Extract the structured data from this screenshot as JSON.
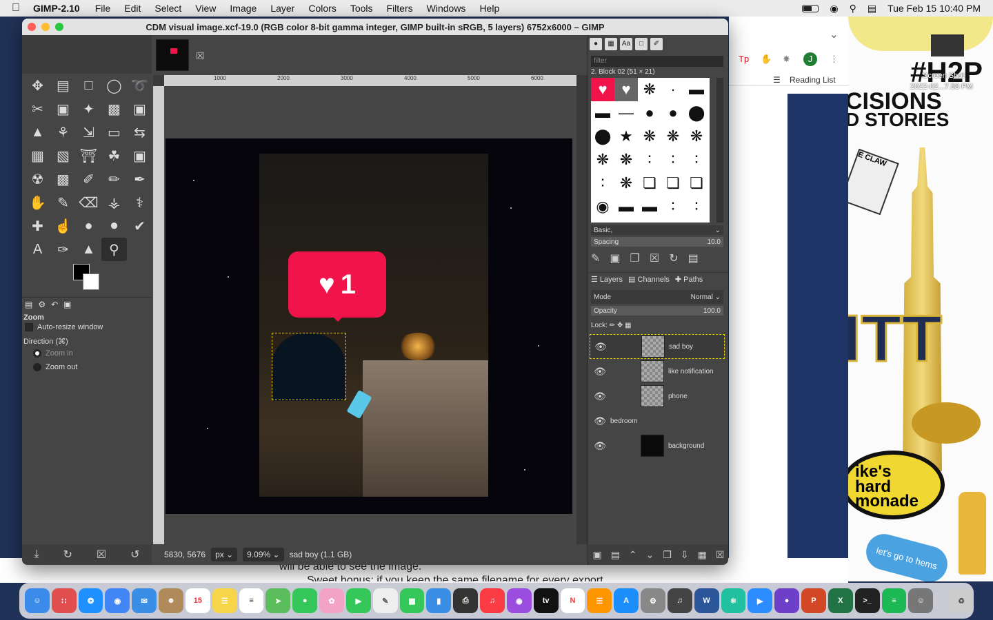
{
  "menubar": {
    "apple": "",
    "app": "GIMP-2.10",
    "items": [
      "File",
      "Edit",
      "Select",
      "View",
      "Image",
      "Layer",
      "Colors",
      "Tools",
      "Filters",
      "Windows",
      "Help"
    ],
    "datetime": "Tue Feb 15  10:40 PM"
  },
  "browser": {
    "reading_list": "Reading List",
    "avatar": "J"
  },
  "stickers": {
    "h2p": "#H2P",
    "decisions": "CISIONS",
    "stories": "D STORIES",
    "screenshot": "Screen Shot",
    "date": "2022-02...7.58 PM",
    "pitt": "ITT",
    "lemonade": "ike's hard monade",
    "blue": "let's go to hems",
    "claw": "E CLAW"
  },
  "doc": {
    "line1": "will be able to see the image.",
    "line2": "Sweet bonus: if you keep the same filename for every export"
  },
  "window": {
    "title": "CDM visual image.xcf-19.0 (RGB color 8-bit gamma integer, GIMP built-in sRGB, 5 layers) 6752x6000 – GIMP"
  },
  "toolopts": {
    "title": "Zoom",
    "autoresize": "Auto-resize window",
    "direction": "Direction  (⌘)",
    "zoomin": "Zoom in",
    "zoomout": "Zoom out"
  },
  "ruler": [
    "1000",
    "2000",
    "3000",
    "4000",
    "5000",
    "6000"
  ],
  "notification": {
    "count": "1"
  },
  "status": {
    "coords": "5830, 5676",
    "unit": "px",
    "zoom": "9.09%",
    "layer": "sad boy (1.1 GB)"
  },
  "brushes": {
    "filter": "filter",
    "name": "2. Block 02 (51 × 21)",
    "preset": "Basic,",
    "spacing_label": "Spacing",
    "spacing_value": "10.0"
  },
  "layers_panel": {
    "tabs": [
      "Layers",
      "Channels",
      "Paths"
    ],
    "mode_label": "Mode",
    "mode_value": "Normal",
    "opacity_label": "Opacity",
    "opacity_value": "100.0",
    "lock_label": "Lock:"
  },
  "layers": [
    "sad boy",
    "like notification",
    "phone",
    "bedroom",
    "background"
  ],
  "colors": {
    "accent": "#f0144a"
  }
}
